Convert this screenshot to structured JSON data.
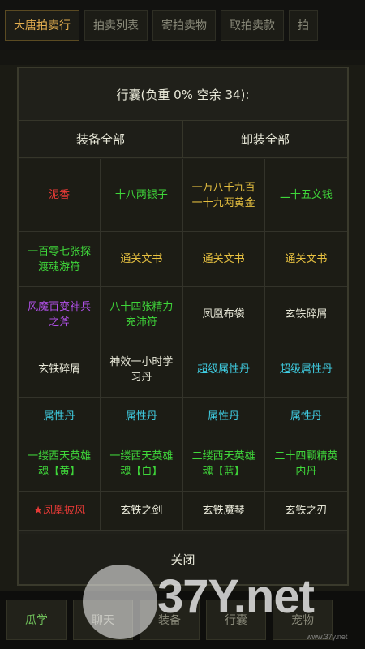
{
  "top_tabs": [
    "大唐拍卖行",
    "拍卖列表",
    "寄拍卖物",
    "取拍卖款",
    "拍"
  ],
  "dialog": {
    "title": "行囊(负重 0% 空余 34):",
    "equip_all": "装备全部",
    "unequip_all": "卸装全部",
    "close": "关闭"
  },
  "items": [
    {
      "label": "泥香",
      "color": "red"
    },
    {
      "label": "十八两银子",
      "color": "green"
    },
    {
      "label": "一万八千九百一十九两黄金",
      "color": "yellow"
    },
    {
      "label": "二十五文钱",
      "color": "green"
    },
    {
      "label": "一百零七张探渡魂游符",
      "color": "green"
    },
    {
      "label": "通关文书",
      "color": "yellow"
    },
    {
      "label": "通关文书",
      "color": "yellow"
    },
    {
      "label": "通关文书",
      "color": "yellow"
    },
    {
      "label": "风魔百变神兵之斧",
      "color": "purple"
    },
    {
      "label": "八十四张精力充沛符",
      "color": "green"
    },
    {
      "label": "凤凰布袋",
      "color": "red-white"
    },
    {
      "label": "玄铁碎屑",
      "color": "white"
    },
    {
      "label": "玄铁碎屑",
      "color": "white"
    },
    {
      "label": "神效一小时学习丹",
      "color": "white"
    },
    {
      "label": "超级属性丹",
      "color": "cyan"
    },
    {
      "label": "超级属性丹",
      "color": "cyan"
    },
    {
      "label": "属性丹",
      "color": "cyan"
    },
    {
      "label": "属性丹",
      "color": "cyan"
    },
    {
      "label": "属性丹",
      "color": "cyan"
    },
    {
      "label": "属性丹",
      "color": "cyan"
    },
    {
      "label": "一缕西天英雄魂【黄】",
      "color": "yellow-green"
    },
    {
      "label": "一缕西天英雄魂【白】",
      "color": "white-green"
    },
    {
      "label": "二缕西天英雄魂【蓝】",
      "color": "blue-green"
    },
    {
      "label": "二十四颗精英内丹",
      "color": "green-yellow"
    },
    {
      "label": "★凤凰披风",
      "color": "red-star"
    },
    {
      "label": "玄铁之剑",
      "color": "white"
    },
    {
      "label": "玄铁魔琴",
      "color": "white"
    },
    {
      "label": "玄铁之刃",
      "color": "white"
    }
  ],
  "bottom_tabs": [
    "瓜学",
    "聊天",
    "装备",
    "行囊",
    "宠物"
  ],
  "watermark": {
    "text": "37Y.net",
    "sub": "www.37y.net"
  },
  "colors": {
    "red": "#e63a36",
    "green": "#3fd63a",
    "yellow": "#e6c040",
    "purple": "#b050e8",
    "white": "#e8e8d8",
    "cyan": "#40d0e6",
    "blue": "#40a8ff"
  }
}
